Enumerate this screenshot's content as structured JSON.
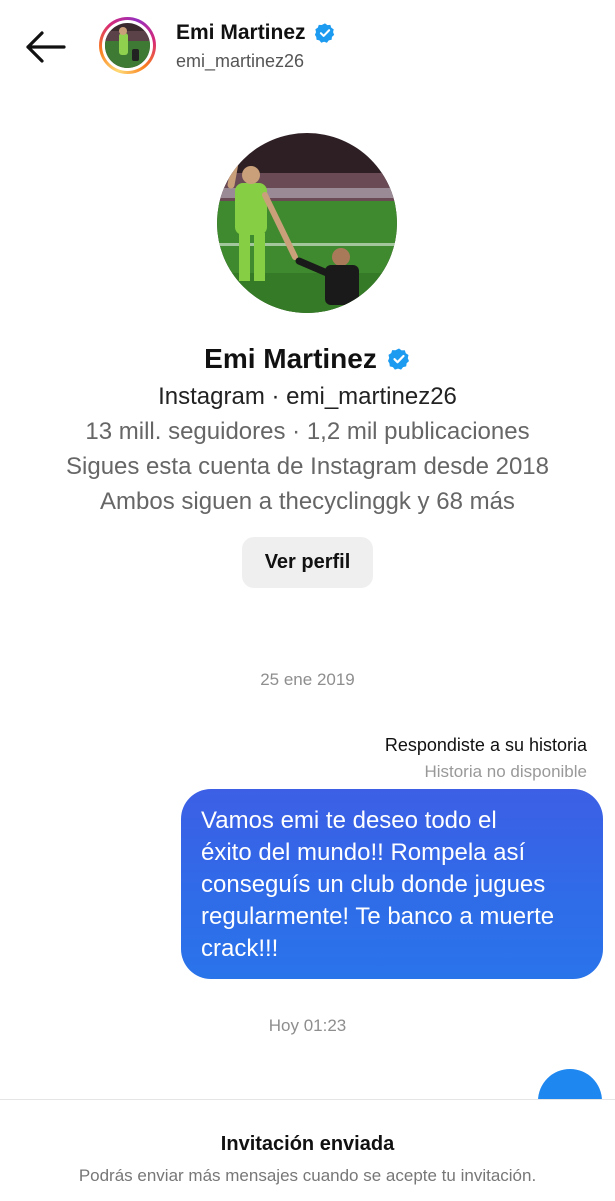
{
  "header": {
    "name": "Emi Martinez",
    "username": "emi_martinez26",
    "back_icon": "arrow-left-icon",
    "verified_icon": "verified-badge-icon"
  },
  "profile": {
    "name": "Emi Martinez",
    "platform_line": "Instagram · emi_martinez26",
    "stats_line": "13 mill. seguidores · 1,2 mil publicaciones",
    "follow_since_line": "Sigues esta cuenta de Instagram desde 2018",
    "mutual_line": "Ambos siguen a thecyclinggk y 68 más",
    "view_profile_label": "Ver perfil"
  },
  "conversation": {
    "first_timestamp": "25 ene 2019",
    "reply_context_title": "Respondiste a su historia",
    "reply_context_sub": "Historia no disponible",
    "message_lines": [
      "Vamos emi te deseo todo el",
      "éxito del mundo!! Rompela así",
      "conseguís un club donde jugues",
      "regularmente! Te banco a muerte",
      "crack!!!"
    ],
    "second_timestamp": "Hoy 01:23"
  },
  "footer": {
    "title": "Invitación enviada",
    "subtitle": "Podrás enviar más mensajes cuando se acepte tu invitación."
  },
  "colors": {
    "bubble": "#3064e8",
    "verified": "#1d9bf0",
    "fab": "#1f88f0"
  }
}
